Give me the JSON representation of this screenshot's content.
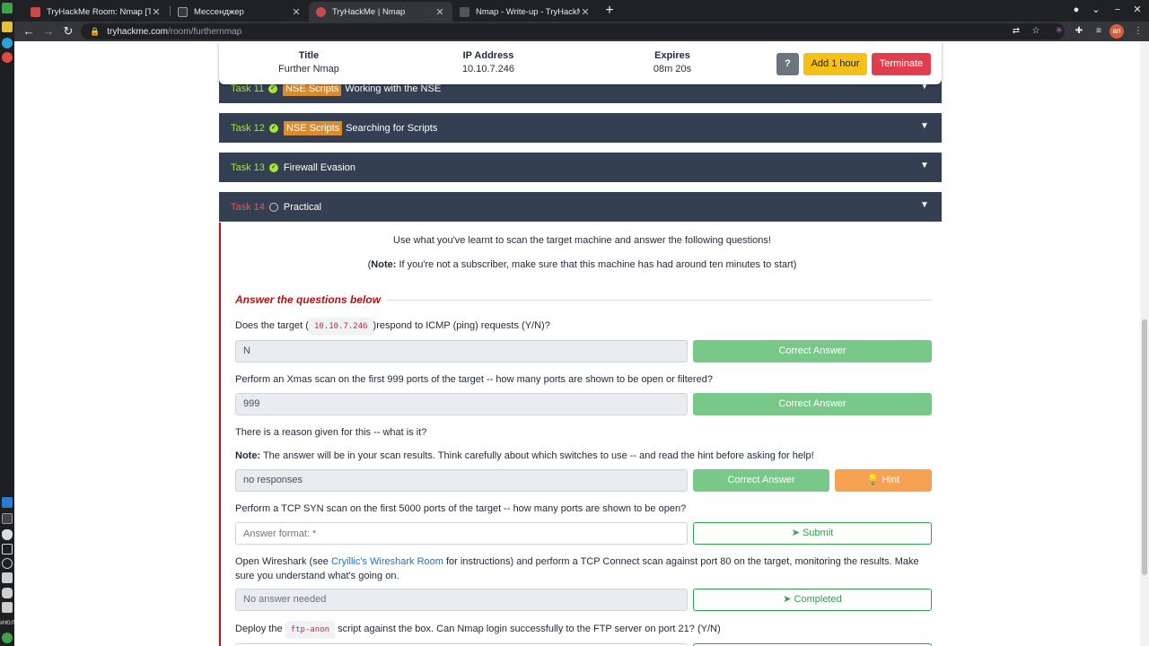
{
  "dock": {
    "bottom_label": "июл"
  },
  "browser": {
    "tabs": [
      {
        "title": "TryHackMe Room: Nmap [Ta",
        "favicon_color": "#c94a4a",
        "active": false
      },
      {
        "title": "Мессенджер",
        "favicon_color": "#3a3a3a",
        "active": false
      },
      {
        "title": "TryHackMe | Nmap",
        "favicon_color": "#c94a4a",
        "active": true
      },
      {
        "title": "Nmap - Write-up - TryHackM",
        "favicon_color": "#3a3a3a",
        "active": false
      }
    ],
    "new_tab_label": "+",
    "close_glyph": "✕",
    "url_host": "tryhackme.com",
    "url_path": "/room/furthernmap",
    "profile_initials": "an"
  },
  "machine": {
    "title_label": "Title",
    "title_value": "Further Nmap",
    "ip_label": "IP Address",
    "ip_value": "10.10.7.246",
    "expires_label": "Expires",
    "expires_value": "08m 20s",
    "help_label": "?",
    "add_hour_label": "Add 1 hour",
    "terminate_label": "Terminate"
  },
  "tasks": [
    {
      "num": "Task 11",
      "badge": "NSE Scripts",
      "title": "Working with the NSE",
      "done": true
    },
    {
      "num": "Task 12",
      "badge": "NSE Scripts",
      "title": "Searching for Scripts",
      "done": true
    },
    {
      "num": "Task 13",
      "badge": "",
      "title": "Firewall Evasion",
      "done": true
    },
    {
      "num": "Task 14",
      "badge": "",
      "title": "Practical",
      "done": false
    }
  ],
  "practical": {
    "intro": "Use what you've learnt to scan the target machine and answer the following questions!",
    "note_prefix": "(",
    "note_bold": "Note:",
    "note_text": " If you're not a subscriber, make sure that this machine has had around ten minutes to start)",
    "section_title": "Answer the questions below",
    "q1_pre": "Does the target (",
    "q1_code": "10.10.7.246",
    "q1_post": ")respond to ICMP (ping) requests (Y/N)?",
    "q1_answer": "N",
    "q1_button": "Correct Answer",
    "q2_text": "Perform an Xmas scan on the first 999 ports of the target -- how many ports are shown to be open or filtered?",
    "q2_answer": "999",
    "q2_button": "Correct Answer",
    "q3_text": "There is a reason given for this -- what is it?",
    "q3_note_bold": "Note:",
    "q3_note_text": " The answer will be in your scan results. Think carefully about which switches to use -- and read the hint before asking for help!",
    "q3_answer": "no responses",
    "q3_button": "Correct Answer",
    "q3_hint": "Hint",
    "q4_text": "Perform a TCP SYN scan on the first 5000 ports of the target -- how many ports are shown to be open?",
    "q4_placeholder": "Answer format: *",
    "q4_button": "Submit",
    "q5_pre": "Open Wireshark (see ",
    "q5_link": "Cryillic's Wireshark Room",
    "q5_post": " for instructions) and perform a TCP Connect scan against port 80 on the target, monitoring the results. Make sure you understand what's going on.",
    "q5_answer": "No answer needed",
    "q5_button": "Completed",
    "q6_pre": "Deploy the ",
    "q6_code": "ftp-anon",
    "q6_post": " script against the box. Can Nmap login successfully to the FTP server on port 21? (Y/N)"
  },
  "colors": {
    "task_bar_bg": "#343f52",
    "task_done_green": "#a3ea2a",
    "task_active_red": "#e8555a",
    "correct_green": "#78c889",
    "hint_orange": "#f7a253",
    "add_hour_yellow": "#f5c018",
    "terminate_red": "#e03e4d"
  }
}
